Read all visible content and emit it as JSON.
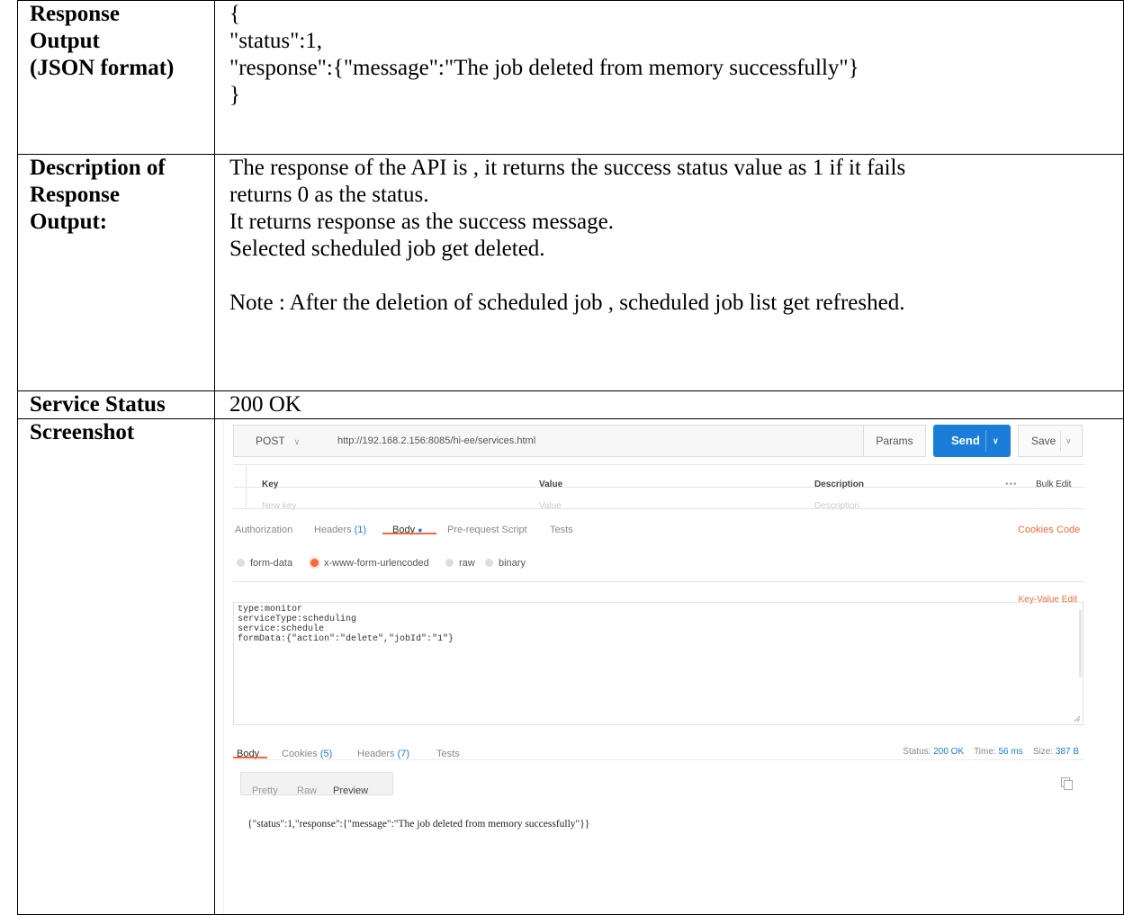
{
  "rows": {
    "response_output": {
      "label_lines": [
        "Response",
        "Output",
        "(JSON format)"
      ],
      "value_lines": [
        "{",
        "\"status\":1,",
        "\"response\":{\"message\":\"The job deleted from memory successfully\"}",
        "}"
      ]
    },
    "description": {
      "label_lines": [
        "Description of",
        "Response",
        "Output:"
      ],
      "value_lines": [
        "The response of the API is , it returns the success status value as 1 if it fails",
        "returns 0 as the status.",
        "It returns response as the success message.",
        "Selected scheduled job get deleted.",
        "",
        "Note : After the deletion of scheduled job , scheduled job list get refreshed."
      ]
    },
    "service_status": {
      "label": "Service Status",
      "value": "200 OK"
    },
    "screenshot": {
      "label": "Screenshot"
    }
  },
  "postman": {
    "method": "POST",
    "url": "http://192.168.2.156:8085/hi-ee/services.html",
    "params_label": "Params",
    "send_label": "Send",
    "save_label": "Save",
    "params_table": {
      "headers": [
        "Key",
        "Value",
        "Description"
      ],
      "placeholders": [
        "New key",
        "Value",
        "Description"
      ],
      "more_label": "•••",
      "bulk_edit_label": "Bulk Edit"
    },
    "request_tabs": {
      "authorization": "Authorization",
      "headers": "Headers",
      "headers_count": "(1)",
      "body": "Body",
      "body_dot": "●",
      "prerequest": "Pre-request Script",
      "tests": "Tests",
      "cookies": "Cookies",
      "code": "Code"
    },
    "body_options": {
      "form_data": "form-data",
      "urlencoded": "x-www-form-urlencoded",
      "raw": "raw",
      "binary": "binary",
      "selected": "x-www-form-urlencoded"
    },
    "key_value_edit_label": "Key-Value Edit",
    "bulk_body_lines": [
      "type:monitor",
      "serviceType:scheduling",
      "service:schedule",
      "formData:{\"action\":\"delete\",\"jobId\":\"1\"}"
    ],
    "response_tabs": {
      "body": "Body",
      "cookies": "Cookies",
      "cookies_count": "(5)",
      "headers": "Headers",
      "headers_count": "(7)",
      "tests": "Tests"
    },
    "response_meta": {
      "status_label": "Status:",
      "status_value": "200 OK",
      "time_label": "Time:",
      "time_value": "56 ms",
      "size_label": "Size:",
      "size_value": "387 B"
    },
    "view_buttons": {
      "pretty": "Pretty",
      "raw": "Raw",
      "preview": "Preview",
      "selected": "Preview"
    },
    "response_body": "{\"status\":1,\"response\":{\"message\":\"The job deleted from memory successfully\"}}",
    "colors": {
      "send": "#1a7ed8",
      "accent": "#f26b3a",
      "link": "#1a7ed8"
    }
  }
}
